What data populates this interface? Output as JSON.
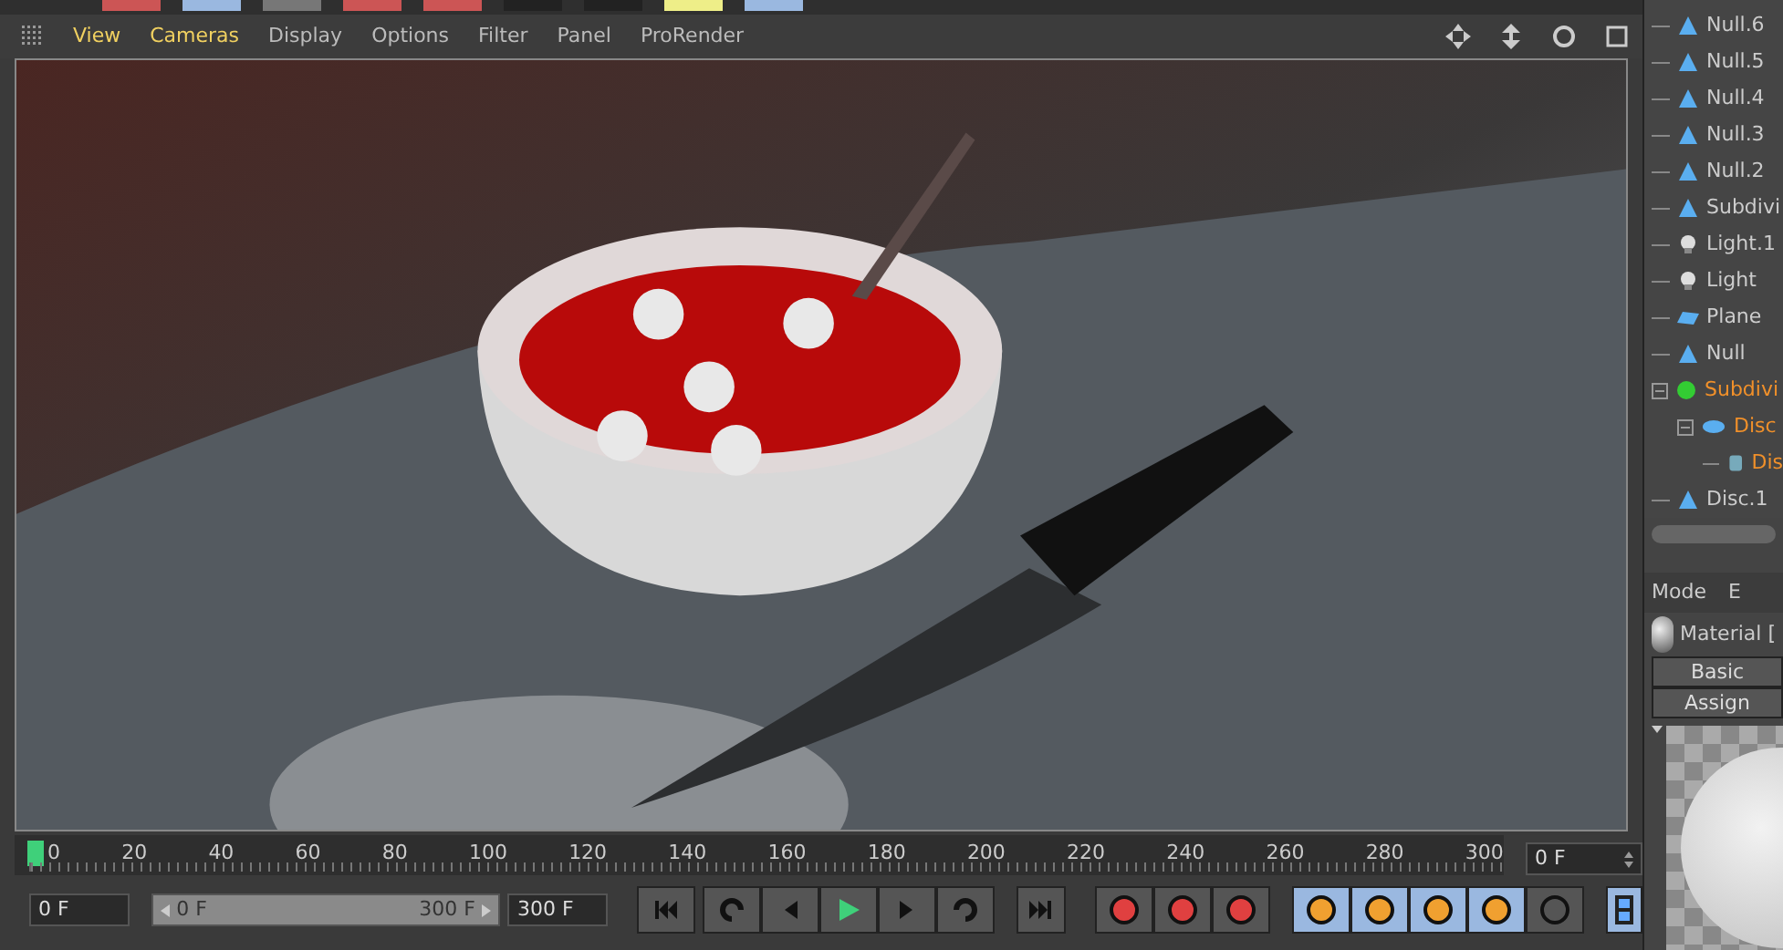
{
  "viewport_menu": [
    {
      "label": "View",
      "highlighted": true
    },
    {
      "label": "Cameras",
      "highlighted": true
    },
    {
      "label": "Display",
      "highlighted": false
    },
    {
      "label": "Options",
      "highlighted": false
    },
    {
      "label": "Filter",
      "highlighted": false
    },
    {
      "label": "Panel",
      "highlighted": false
    },
    {
      "label": "ProRender",
      "highlighted": false
    }
  ],
  "objects": [
    {
      "name": "Null.6",
      "kind": "null",
      "selected": false
    },
    {
      "name": "Null.5",
      "kind": "null",
      "selected": false
    },
    {
      "name": "Null.4",
      "kind": "null",
      "selected": false
    },
    {
      "name": "Null.3",
      "kind": "null",
      "selected": false
    },
    {
      "name": "Null.2",
      "kind": "null",
      "selected": false
    },
    {
      "name": "Subdivi",
      "kind": "null",
      "selected": false
    },
    {
      "name": "Light.1",
      "kind": "light",
      "selected": false
    },
    {
      "name": "Light",
      "kind": "light",
      "selected": false
    },
    {
      "name": "Plane",
      "kind": "plane",
      "selected": false
    },
    {
      "name": "Null",
      "kind": "null",
      "selected": false
    },
    {
      "name": "Subdivi",
      "kind": "subdiv",
      "selected": true,
      "expanded": true,
      "children": [
        {
          "name": "Disc",
          "kind": "disc",
          "selected": true,
          "expanded": true,
          "children": [
            {
              "name": "Dis",
              "kind": "poly",
              "selected": true
            }
          ]
        }
      ]
    },
    {
      "name": "Disc.1",
      "kind": "null",
      "selected": false
    }
  ],
  "attributes": {
    "menu": [
      "Mode",
      "E"
    ],
    "material_label": "Material [",
    "tabs": [
      {
        "label": "Basic",
        "selected": false
      },
      {
        "label": "Assign",
        "selected": false
      }
    ]
  },
  "timeline": {
    "ticks": [
      "0",
      "20",
      "40",
      "60",
      "80",
      "100",
      "120",
      "140",
      "160",
      "180",
      "200",
      "220",
      "240",
      "260",
      "280",
      "300"
    ],
    "level": 0.0,
    "frame": "0 F"
  },
  "controls": {
    "level": 1,
    "start": "0 F",
    "range_start": "0 F",
    "range_end": "300 F",
    "end": "300 F"
  }
}
